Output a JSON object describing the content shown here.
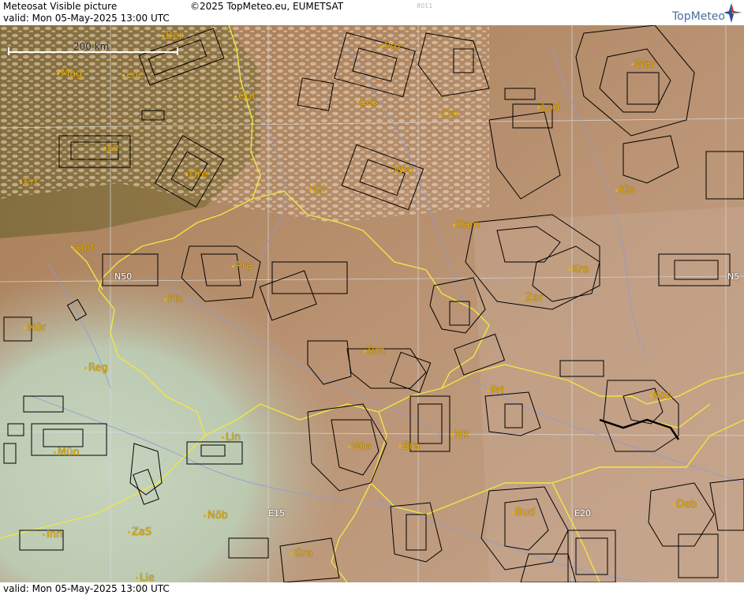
{
  "header": {
    "title": "Meteosat Visible picture",
    "copyright": "©2025 TopMeteo.eu, EUMETSAT",
    "code": "8011",
    "valid": "valid:  Mon  05-May-2025  13:00 UTC",
    "logo_text": "TopMeteo"
  },
  "footer": {
    "valid": "valid:  Mon  05-May-2025  13:00 UTC"
  },
  "map": {
    "scale_label": "200 km",
    "grid_labels": [
      "N50",
      "N5",
      "E15",
      "E20"
    ],
    "cities": [
      "Ber",
      "Poz",
      "War",
      "Mag",
      "Loc",
      "Cot",
      "Les",
      "Ost",
      "Lod",
      "Le",
      "Wro",
      "Dre",
      "Erf",
      "Jel",
      "Kie",
      "Kam",
      "Hof",
      "Pra",
      "Kra",
      "Plz",
      "Zar",
      "Nür",
      "Brn",
      "Reg",
      "Pri",
      "Kos",
      "Nit",
      "Lin",
      "Wie",
      "Bra",
      "Mün",
      "Nöb",
      "Bud",
      "Deb",
      "Inn",
      "ZaS",
      "Gra",
      "Lie"
    ],
    "colors": {
      "border": "#f2e640",
      "river": "#8f9ad8",
      "grid": "#d8dae0",
      "city": "#e8b000",
      "contour": "#000000"
    }
  }
}
